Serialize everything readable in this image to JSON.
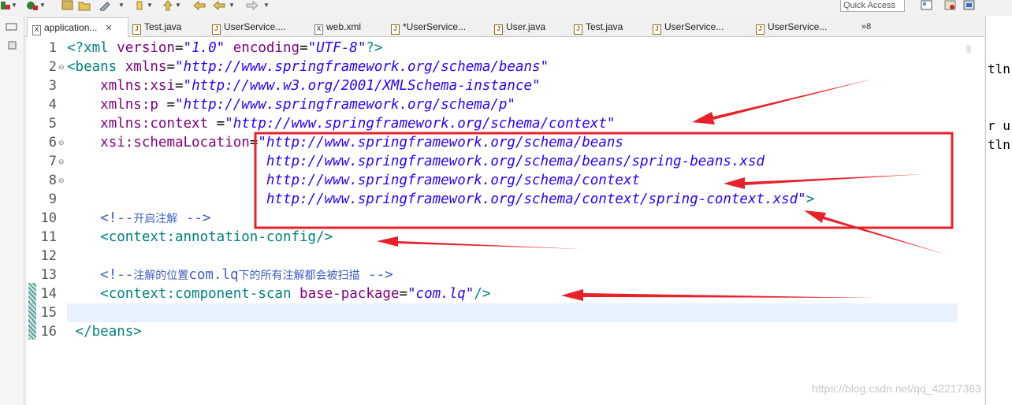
{
  "toolbar": {
    "quick_access_placeholder": "Quick Access"
  },
  "tabs": [
    {
      "label": "application...",
      "icon": "xml-file-icon",
      "active": true,
      "closable": true
    },
    {
      "label": "Test.java",
      "icon": "java-file-icon"
    },
    {
      "label": "UserService....",
      "icon": "java-file-icon"
    },
    {
      "label": "web.xml",
      "icon": "xml-file-icon"
    },
    {
      "label": "*UserService...",
      "icon": "java-file-icon"
    },
    {
      "label": "User.java",
      "icon": "java-file-icon"
    },
    {
      "label": "Test.java",
      "icon": "java-file-icon"
    },
    {
      "label": "UserService...",
      "icon": "java-file-icon"
    },
    {
      "label": "UserService...",
      "icon": "java-file-icon"
    }
  ],
  "tab_overflow": "»8",
  "editor": {
    "line_numbers": [
      "1",
      "2",
      "3",
      "4",
      "5",
      "6",
      "7",
      "8",
      "9",
      "10",
      "11",
      "12",
      "13",
      "14",
      "15",
      "16"
    ],
    "current_line": 15,
    "lines": {
      "l1": {
        "p1": "<?xml ",
        "p2": "version",
        "p3": "=",
        "p4": "\"1.0\"",
        "p5": " ",
        "p6": "encoding",
        "p7": "=",
        "p8": "\"UTF-8\"",
        "p9": "?>"
      },
      "l2": {
        "p1": "<beans ",
        "p2": "xmlns",
        "p3": "=",
        "p4": "\"http://www.springframework.org/schema/beans\""
      },
      "l3": {
        "p2": "xmlns:xsi",
        "p3": "=",
        "p4": "\"http://www.w3.org/2001/XMLSchema-instance\""
      },
      "l4": {
        "p2": "xmlns:p ",
        "p3": "=",
        "p4": "\"http://www.springframework.org/schema/p\""
      },
      "l5": {
        "p2": "xmlns:context ",
        "p3": "=",
        "p4": "\"http://www.springframework.org/schema/context\""
      },
      "l6": {
        "p2": "xsi:schemaLocation",
        "p3": "=",
        "p4": "\"http://www.springframework.org/schema/beans"
      },
      "l7": {
        "p4": "http://www.springframework.org/schema/beans/spring-beans.xsd"
      },
      "l8": {
        "p4": "http://www.springframework.org/schema/context"
      },
      "l9": {
        "p4": "http://www.springframework.org/schema/context/spring-context.xsd\"",
        "p5": ">"
      },
      "l10": {
        "c1": "<!--",
        "c2": "开启注解",
        "c3": " -->"
      },
      "l11": {
        "p1": "<context:annotation-config/>"
      },
      "l13": {
        "c1": "<!--",
        "c2": "注解的位置",
        "c3": "com.lq",
        "c4": "下的所有注解都会被扫描",
        "c5": " -->"
      },
      "l14": {
        "p1": "<context:component-scan ",
        "p2": "base-package",
        "p3": "=",
        "p4": "\"com.lq\"",
        "p5": "/>"
      },
      "l16": {
        "p1": "</beans>"
      }
    }
  },
  "right_panel": {
    "line1": "tln",
    "line2": "r u",
    "line3": "tln"
  },
  "watermark": "https://blog.csdn.net/qq_42217363",
  "colors": {
    "tag": "#008080",
    "attribute": "#7f007f",
    "value": "#2a00ff",
    "comment": "#3f5fbf",
    "annotation": "#e8202a",
    "current_line": "#e8f2fe"
  }
}
